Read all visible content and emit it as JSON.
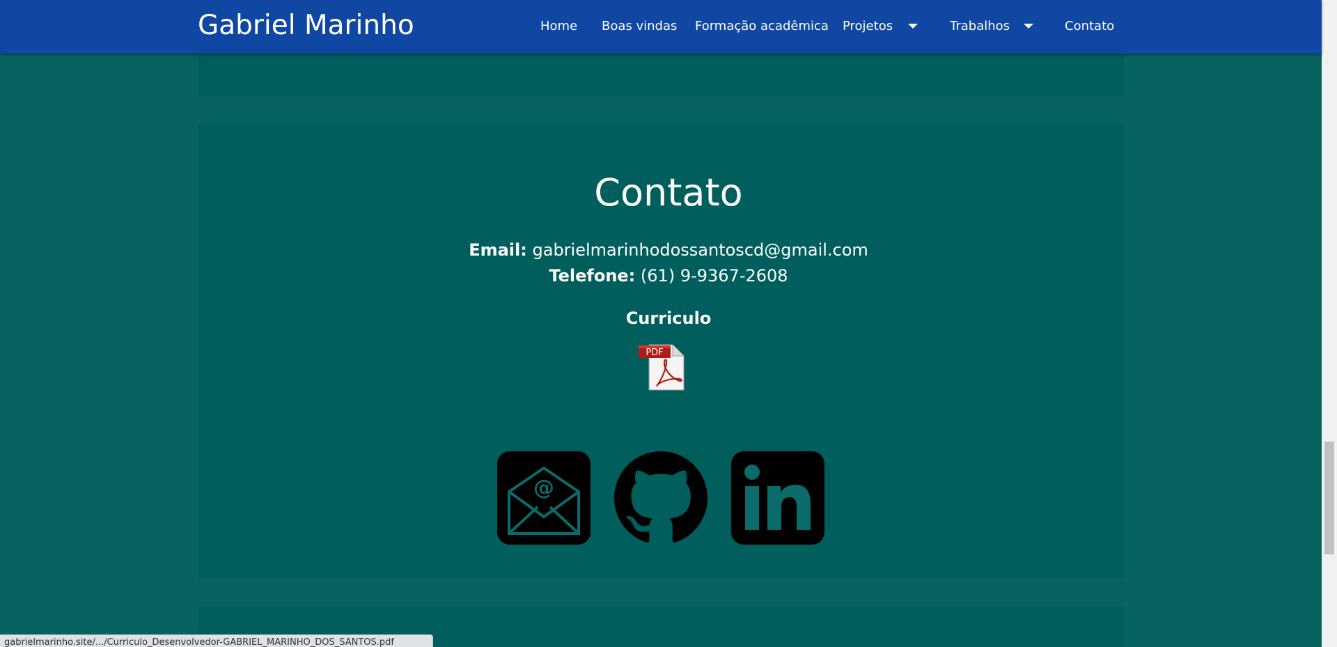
{
  "navbar": {
    "brand": "Gabriel Marinho",
    "items": [
      {
        "label": "Home"
      },
      {
        "label": "Boas vindas"
      },
      {
        "label": "Formação acadêmica"
      },
      {
        "label": "Projetos",
        "dropdown": true
      },
      {
        "label": "Trabalhos",
        "dropdown": true
      },
      {
        "label": "Contato"
      }
    ]
  },
  "contact": {
    "title": "Contato",
    "email_label": "Email:",
    "email_value": "gabrielmarinhodossantoscd@gmail.com",
    "phone_label": "Telefone:",
    "phone_value": "(61) 9-9367-2608",
    "curriculo_label": "Curriculo",
    "pdf_badge": "PDF",
    "social": [
      {
        "icon": "email-icon"
      },
      {
        "icon": "github-icon"
      },
      {
        "icon": "linkedin-icon"
      }
    ]
  },
  "status_bar": {
    "url": "gabrielmarinho.site/.../Curriculo_Desenvolvedor-GABRIEL_MARINHO_DOS_SANTOS.pdf"
  },
  "colors": {
    "navbar": "#0f47a3",
    "page_background": "#08625f",
    "section_background": "#005e5d",
    "text": "#ffffff"
  }
}
